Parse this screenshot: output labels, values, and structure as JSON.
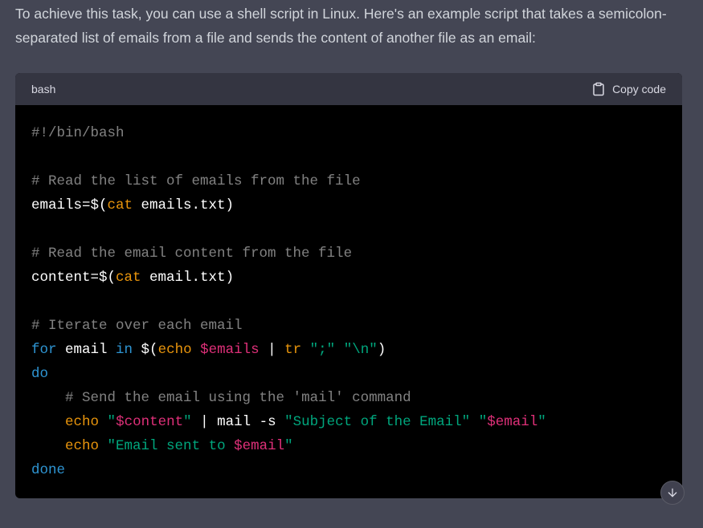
{
  "message": {
    "intro": "To achieve this task, you can use a shell script in Linux. Here's an example script that takes a semicolon-separated list of emails from a file and sends the content of another file as an email:"
  },
  "codeblock": {
    "language": "bash",
    "copy_label": "Copy code",
    "lines": [
      [
        [
          "comment",
          "#!/bin/bash"
        ]
      ],
      [],
      [
        [
          "comment",
          "# Read the list of emails from the file"
        ]
      ],
      [
        [
          "plain",
          "emails=$("
        ],
        [
          "built",
          "cat"
        ],
        [
          "plain",
          " emails.txt)"
        ]
      ],
      [],
      [
        [
          "comment",
          "# Read the email content from the file"
        ]
      ],
      [
        [
          "plain",
          "content=$("
        ],
        [
          "built",
          "cat"
        ],
        [
          "plain",
          " email.txt)"
        ]
      ],
      [],
      [
        [
          "comment",
          "# Iterate over each email"
        ]
      ],
      [
        [
          "kw",
          "for"
        ],
        [
          "plain",
          " email "
        ],
        [
          "kw",
          "in"
        ],
        [
          "plain",
          " $("
        ],
        [
          "built",
          "echo"
        ],
        [
          "plain",
          " "
        ],
        [
          "var",
          "$emails"
        ],
        [
          "plain",
          " | "
        ],
        [
          "built",
          "tr"
        ],
        [
          "plain",
          " "
        ],
        [
          "str",
          "\";\""
        ],
        [
          "plain",
          " "
        ],
        [
          "str",
          "\"\\n\""
        ],
        [
          "plain",
          ")"
        ]
      ],
      [
        [
          "kw",
          "do"
        ]
      ],
      [
        [
          "plain",
          "    "
        ],
        [
          "comment",
          "# Send the email using the 'mail' command"
        ]
      ],
      [
        [
          "plain",
          "    "
        ],
        [
          "built",
          "echo"
        ],
        [
          "plain",
          " "
        ],
        [
          "str",
          "\""
        ],
        [
          "var",
          "$content"
        ],
        [
          "str",
          "\""
        ],
        [
          "plain",
          " | mail -s "
        ],
        [
          "str",
          "\"Subject of the Email\""
        ],
        [
          "plain",
          " "
        ],
        [
          "str",
          "\""
        ],
        [
          "var",
          "$email"
        ],
        [
          "str",
          "\""
        ]
      ],
      [
        [
          "plain",
          "    "
        ],
        [
          "built",
          "echo"
        ],
        [
          "plain",
          " "
        ],
        [
          "str",
          "\"Email sent to "
        ],
        [
          "var",
          "$email"
        ],
        [
          "str",
          "\""
        ]
      ],
      [
        [
          "kw",
          "done"
        ]
      ]
    ]
  },
  "icons": {
    "copy": "clipboard-icon",
    "scroll": "arrow-down-icon"
  }
}
